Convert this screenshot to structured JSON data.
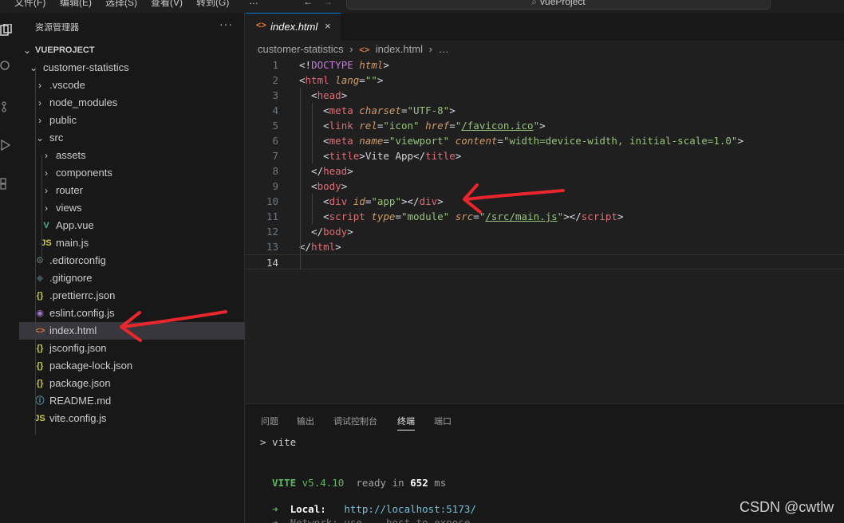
{
  "menubar": {
    "items": [
      "文件(F)",
      "编辑(E)",
      "选择(S)",
      "查看(V)",
      "转到(G)",
      "…"
    ],
    "search_text": "vueProject"
  },
  "sidebar": {
    "title": "资源管理器",
    "more": "···",
    "root": "VUEPROJECT",
    "tree": [
      {
        "label": "customer-statistics",
        "icon": "chevron-down-icon"
      },
      {
        "label": ".vscode",
        "icon": "chevron-right-icon"
      },
      {
        "label": "node_modules",
        "icon": "chevron-right-icon"
      },
      {
        "label": "public",
        "icon": "chevron-right-icon"
      },
      {
        "label": "src",
        "icon": "chevron-down-icon"
      },
      {
        "label": "assets",
        "icon": "chevron-right-icon"
      },
      {
        "label": "components",
        "icon": "chevron-right-icon"
      },
      {
        "label": "router",
        "icon": "chevron-right-icon"
      },
      {
        "label": "views",
        "icon": "chevron-right-icon"
      },
      {
        "label": "App.vue",
        "icon": "vue-icon",
        "glyph": "V"
      },
      {
        "label": "main.js",
        "icon": "js-icon",
        "glyph": "JS"
      },
      {
        "label": ".editorconfig",
        "icon": "gear-icon",
        "glyph": "⚙"
      },
      {
        "label": ".gitignore",
        "icon": "git-icon",
        "glyph": "◆"
      },
      {
        "label": ".prettierrc.json",
        "icon": "json-icon",
        "glyph": "{}"
      },
      {
        "label": "eslint.config.js",
        "icon": "eslint-icon",
        "glyph": "◉"
      },
      {
        "label": "index.html",
        "icon": "html-icon",
        "glyph": "<>"
      },
      {
        "label": "jsconfig.json",
        "icon": "json-icon",
        "glyph": "{}"
      },
      {
        "label": "package-lock.json",
        "icon": "json-icon",
        "glyph": "{}"
      },
      {
        "label": "package.json",
        "icon": "json-icon",
        "glyph": "{}"
      },
      {
        "label": "README.md",
        "icon": "info-icon",
        "glyph": "ⓘ"
      },
      {
        "label": "vite.config.js",
        "icon": "js-icon",
        "glyph": "JS"
      }
    ]
  },
  "editor": {
    "tab": {
      "label": "index.html",
      "icon": "html-icon",
      "close": "×"
    },
    "breadcrumb": [
      "customer-statistics",
      "›",
      "<>",
      "index.html",
      "›",
      "…"
    ],
    "lines": [
      [
        [
          "p",
          "<!"
        ],
        [
          "dt",
          "DOCTYPE"
        ],
        [
          "p",
          " "
        ],
        [
          "dt2",
          "html"
        ],
        [
          "p",
          ">"
        ]
      ],
      [
        [
          "p",
          "<"
        ],
        [
          "t",
          "html"
        ],
        [
          "p",
          " "
        ],
        [
          "a",
          "lang"
        ],
        [
          "p",
          "="
        ],
        [
          "s",
          "\"\""
        ],
        [
          "p",
          ">"
        ]
      ],
      [
        [
          "p",
          "  <"
        ],
        [
          "t",
          "head"
        ],
        [
          "p",
          ">"
        ]
      ],
      [
        [
          "p",
          "    <"
        ],
        [
          "t",
          "meta"
        ],
        [
          "p",
          " "
        ],
        [
          "a",
          "charset"
        ],
        [
          "p",
          "="
        ],
        [
          "s",
          "\"UTF-8\""
        ],
        [
          "p",
          ">"
        ]
      ],
      [
        [
          "p",
          "    <"
        ],
        [
          "t",
          "link"
        ],
        [
          "p",
          " "
        ],
        [
          "a",
          "rel"
        ],
        [
          "p",
          "="
        ],
        [
          "s",
          "\"icon\""
        ],
        [
          "p",
          " "
        ],
        [
          "a",
          "href"
        ],
        [
          "p",
          "="
        ],
        [
          "s",
          "\""
        ],
        [
          "su",
          "/favicon.ico"
        ],
        [
          "s",
          "\""
        ],
        [
          "p",
          ">"
        ]
      ],
      [
        [
          "p",
          "    <"
        ],
        [
          "t",
          "meta"
        ],
        [
          "p",
          " "
        ],
        [
          "a",
          "name"
        ],
        [
          "p",
          "="
        ],
        [
          "s",
          "\"viewport\""
        ],
        [
          "p",
          " "
        ],
        [
          "a",
          "content"
        ],
        [
          "p",
          "="
        ],
        [
          "s",
          "\"width=device-width, initial-scale=1.0\""
        ],
        [
          "p",
          ">"
        ]
      ],
      [
        [
          "p",
          "    <"
        ],
        [
          "t",
          "title"
        ],
        [
          "p",
          ">"
        ],
        [
          "x",
          "Vite App"
        ],
        [
          "p",
          "</"
        ],
        [
          "t",
          "title"
        ],
        [
          "p",
          ">"
        ]
      ],
      [
        [
          "p",
          "  </"
        ],
        [
          "t",
          "head"
        ],
        [
          "p",
          ">"
        ]
      ],
      [
        [
          "p",
          "  <"
        ],
        [
          "t",
          "body"
        ],
        [
          "p",
          ">"
        ]
      ],
      [
        [
          "p",
          "    <"
        ],
        [
          "t",
          "div"
        ],
        [
          "p",
          " "
        ],
        [
          "a",
          "id"
        ],
        [
          "p",
          "="
        ],
        [
          "s",
          "\"app\""
        ],
        [
          "p",
          "></"
        ],
        [
          "t",
          "div"
        ],
        [
          "p",
          ">"
        ]
      ],
      [
        [
          "p",
          "    <"
        ],
        [
          "t",
          "script"
        ],
        [
          "p",
          " "
        ],
        [
          "a",
          "type"
        ],
        [
          "p",
          "="
        ],
        [
          "s",
          "\"module\""
        ],
        [
          "p",
          " "
        ],
        [
          "a",
          "src"
        ],
        [
          "p",
          "="
        ],
        [
          "s",
          "\""
        ],
        [
          "su",
          "/src/main.js"
        ],
        [
          "s",
          "\""
        ],
        [
          "p",
          "></"
        ],
        [
          "t",
          "script"
        ],
        [
          "p",
          ">"
        ]
      ],
      [
        [
          "p",
          "  </"
        ],
        [
          "t",
          "body"
        ],
        [
          "p",
          ">"
        ]
      ],
      [
        [
          "p",
          "</"
        ],
        [
          "t",
          "html"
        ],
        [
          "p",
          ">"
        ]
      ],
      [
        [
          "p",
          ""
        ]
      ]
    ]
  },
  "panel": {
    "tabs": [
      "问题",
      "输出",
      "调试控制台",
      "终端",
      "端口"
    ],
    "active_tab": "终端",
    "terminal": {
      "prompt": "> vite",
      "vite_name": "VITE",
      "vite_version": "v5.4.10",
      "ready_text": "ready in",
      "ready_ms": "652",
      "ms_unit": "ms",
      "arrow": "➜",
      "local_label": "Local:",
      "local_url": "http://localhost:5173/",
      "network_partial": "➜  Network: use  --host to expose"
    }
  },
  "watermark": "CSDN @cwtlw",
  "colors": {
    "annotation_arrow": "#e8262c",
    "accent": "#0078d4",
    "html_icon": "#e37933"
  }
}
